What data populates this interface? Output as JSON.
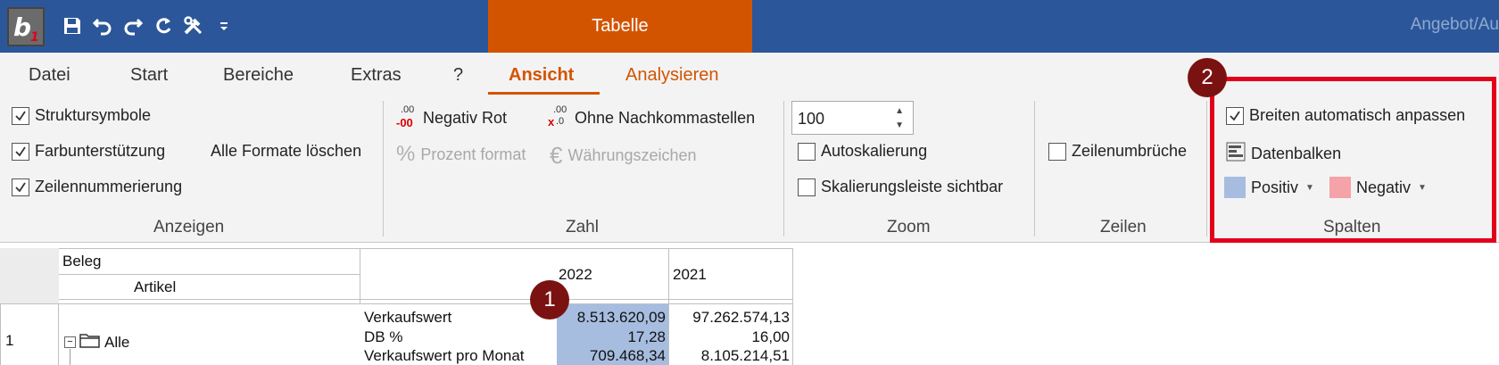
{
  "titlebar": {
    "context_tab": "Tabelle",
    "document_title": "Angebot/Au"
  },
  "menu": {
    "tabs": [
      "Datei",
      "Start",
      "Bereiche",
      "Extras",
      "?",
      "Ansicht",
      "Analysieren"
    ]
  },
  "ribbon": {
    "anzeigen": {
      "label": "Anzeigen",
      "strukturs": "Struktursymbole",
      "farb": "Farbunterstützung",
      "zeilennum": "Zeilennummerierung",
      "formate": "Alle Formate löschen"
    },
    "zahl": {
      "label": "Zahl",
      "negativ_rot": "Negativ Rot",
      "ohne_nachkomma": "Ohne Nachkommastellen",
      "prozent": "Prozent format",
      "waehrung": "Währungszeichen",
      "icon_neg_top": ".00",
      "icon_neg_bottom": "-00",
      "icon_dec_top": ".00",
      "icon_dec_bottom": ".0",
      "icon_x": "x",
      "icon_percent": "%",
      "icon_euro": "€"
    },
    "zoom": {
      "label": "Zoom",
      "value": "100",
      "autoskal": "Autoskalierung",
      "skalleiste": "Skalierungsleiste sichtbar"
    },
    "zeilen": {
      "label": "Zeilen",
      "umbrueche": "Zeilenumbrüche"
    },
    "spalten": {
      "label": "Spalten",
      "breiten": "Breiten automatisch anpassen",
      "datenbalken": "Datenbalken",
      "positiv": "Positiv",
      "negativ": "Negativ"
    }
  },
  "badges": {
    "one": "1",
    "two": "2"
  },
  "colors": {
    "title_bar": "#2b579a",
    "context_tab": "#d35400",
    "positive_swatch": "#a6bde0",
    "negative_swatch": "#f4a3a8",
    "highlight": "#e3001b",
    "badge": "#7b1212"
  },
  "grid": {
    "header_beleg": "Beleg",
    "header_artikel": "Artikel",
    "year1": "2022",
    "year2": "2021",
    "row_number": "1",
    "row_label": "Alle",
    "metrics": [
      {
        "name": "Verkaufswert",
        "v2022": "8.513.620,09",
        "v2021": "97.262.574,13"
      },
      {
        "name": "DB %",
        "v2022": "17,28",
        "v2021": "16,00"
      },
      {
        "name": "Verkaufswert pro Monat",
        "v2022": "709.468,34",
        "v2021": "8.105.214,51"
      }
    ]
  }
}
